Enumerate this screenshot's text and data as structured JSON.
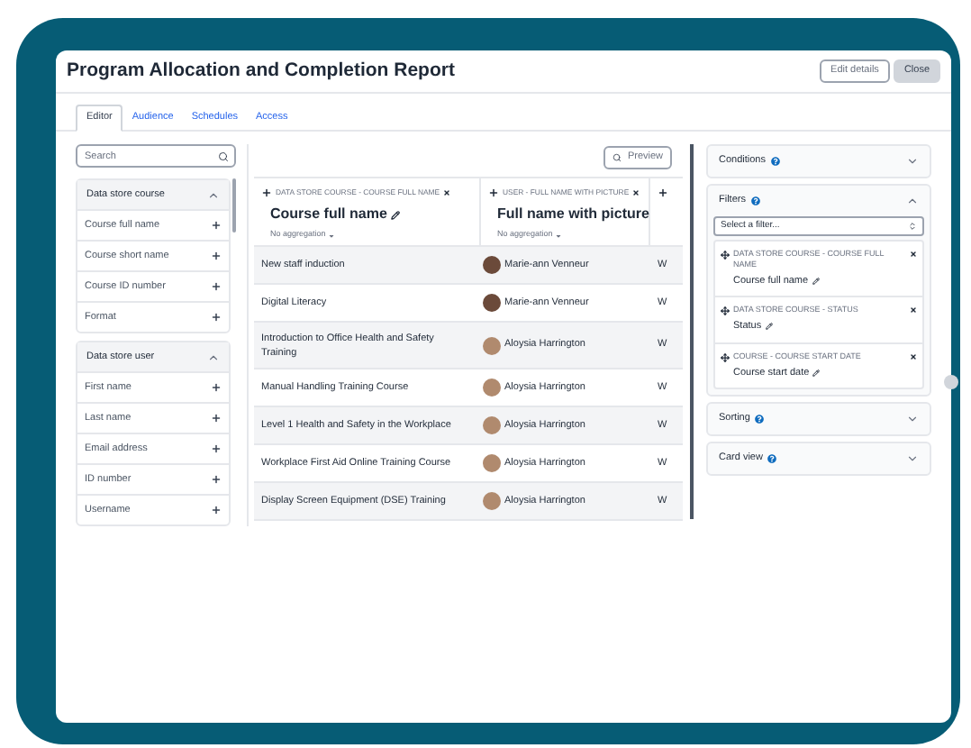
{
  "window": {
    "title": "Program Allocation and Completion Report",
    "buttons": [
      {
        "label": "Edit details",
        "kind": "outline"
      },
      {
        "label": "Close",
        "kind": "filled"
      }
    ]
  },
  "tabs": [
    {
      "label": "Editor",
      "selected": true
    },
    {
      "label": "Audience",
      "selected": false
    },
    {
      "label": "Schedules",
      "selected": false
    },
    {
      "label": "Access",
      "selected": false
    }
  ],
  "sidebar": {
    "search": {
      "placeholder": "Search"
    },
    "groups": [
      {
        "title": "Data store course",
        "expanded": true,
        "items": [
          "Course full name",
          "Course short name",
          "Course ID number",
          "Format"
        ]
      },
      {
        "title": "Data store user",
        "expanded": true,
        "items": [
          "First name",
          "Last name",
          "Email address",
          "ID number",
          "Username"
        ]
      }
    ]
  },
  "table": {
    "preview_button": "Preview",
    "columns": [
      {
        "source": "DATA STORE COURSE - COURSE FULL NAME",
        "title": "Course full name",
        "aggregation": "No aggregation"
      },
      {
        "source": "USER - FULL NAME WITH PICTURE",
        "title": "Full name with picture",
        "aggregation": "No aggregation"
      }
    ],
    "rows": [
      {
        "course": "New staff induction",
        "user": "Marie-ann Venneur",
        "column_3": "W"
      },
      {
        "course": "Digital Literacy",
        "user": "Marie-ann Venneur",
        "column_3": "W"
      },
      {
        "course": "Introduction to Office Health and Safety Training",
        "user": "Aloysia Harrington",
        "column_3": "W"
      },
      {
        "course": "Manual Handling Training Course",
        "user": "Aloysia Harrington",
        "column_3": "W"
      },
      {
        "course": "Level 1 Health and Safety in the Workplace",
        "user": "Aloysia Harrington",
        "column_3": "W"
      },
      {
        "course": "Workplace First Aid Online Training Course",
        "user": "Aloysia Harrington",
        "column_3": "W"
      },
      {
        "course": "Display Screen Equipment (DSE) Training",
        "user": "Aloysia Harrington",
        "column_3": "W"
      }
    ]
  },
  "panel": {
    "sections": [
      {
        "title": "Conditions",
        "expanded": false
      },
      {
        "title": "Filters",
        "expanded": true,
        "select_placeholder": "Select a filter...",
        "filters": [
          {
            "source": "DATA STORE COURSE - COURSE FULL NAME",
            "name": "Course full name"
          },
          {
            "source": "DATA STORE COURSE - STATUS",
            "name": "Status"
          },
          {
            "source": "COURSE - COURSE START DATE",
            "name": "Course start date"
          }
        ]
      },
      {
        "title": "Sorting",
        "expanded": false
      },
      {
        "title": "Card view",
        "expanded": false
      }
    ]
  }
}
